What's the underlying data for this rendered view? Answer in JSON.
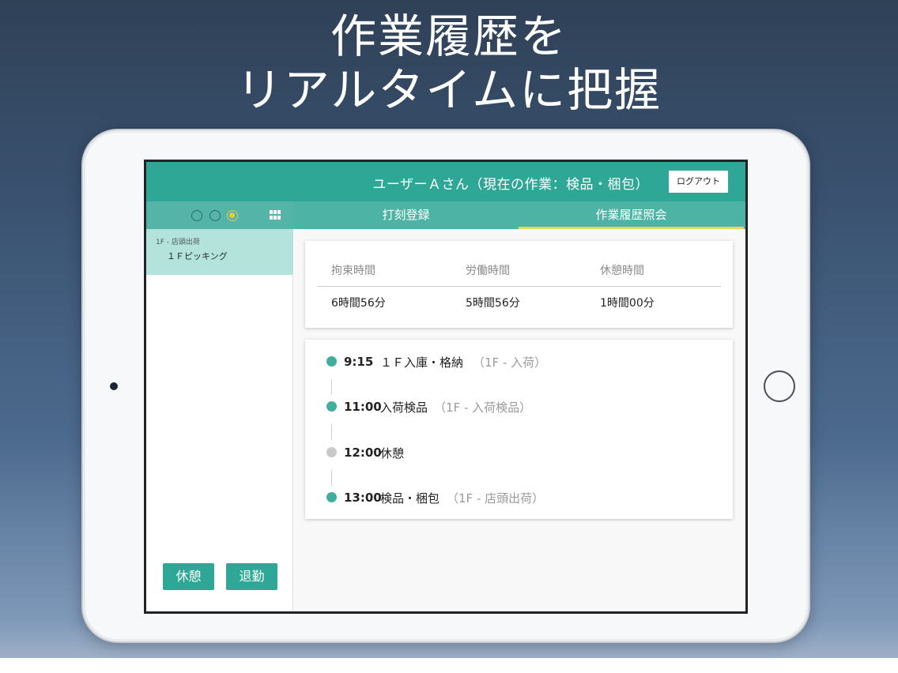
{
  "headline": {
    "line1": "作業履歴を",
    "line2": "リアルタイムに把握"
  },
  "header": {
    "user_status": "ユーザーＡさん（現在の作業：検品・梱包）",
    "logout_label": "ログアウト"
  },
  "tabs": [
    {
      "label": "打刻登録",
      "active": false
    },
    {
      "label": "作業履歴照会",
      "active": true
    }
  ],
  "sidebar": {
    "items": [
      {
        "location": "1F - 店頭出荷",
        "name": "１Ｆピッキング"
      }
    ],
    "break_label": "休憩",
    "leave_label": "退勤"
  },
  "summary": [
    {
      "label": "拘束時間",
      "value": "6時間56分"
    },
    {
      "label": "労働時間",
      "value": "5時間56分"
    },
    {
      "label": "休憩時間",
      "value": "1時間00分"
    }
  ],
  "timeline": [
    {
      "time": "9:15",
      "task": "１Ｆ入庫・格納",
      "location": "（1F - 入荷）",
      "status": "work"
    },
    {
      "time": "11:00",
      "task": "入荷検品",
      "location": "（1F - 入荷検品）",
      "status": "work"
    },
    {
      "time": "12:00",
      "task": "休憩",
      "location": "",
      "status": "break"
    },
    {
      "time": "13:00",
      "task": "検品・梱包",
      "location": "（1F - 店頭出荷）",
      "status": "work"
    }
  ],
  "colors": {
    "accent": "#2ea796",
    "tab_indicator": "#f0d35a",
    "timeline_work": "#3fae9f",
    "timeline_break": "#c9c9c9"
  }
}
